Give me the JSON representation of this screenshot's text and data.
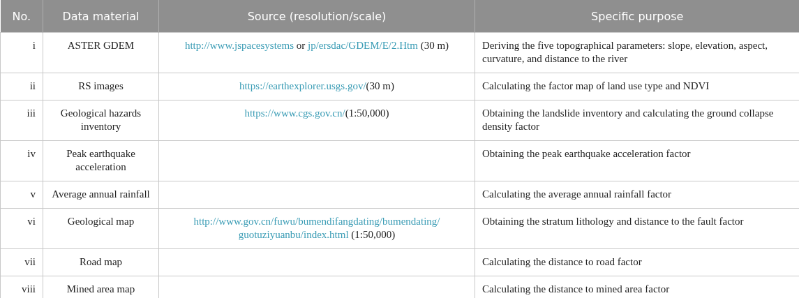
{
  "table": {
    "columns": [
      "No.",
      "Data material",
      "Source (resolution/scale)",
      "Specific purpose"
    ],
    "rows": [
      {
        "no": "i",
        "material": "ASTER GDEM",
        "source": [
          [
            {
              "kind": "link",
              "text": "http://www.jspacesystems"
            },
            {
              "kind": "plain",
              "text": "or"
            },
            {
              "kind": "link",
              "text": "jp/ersdac/GDEM/E/2.Htm"
            },
            {
              "kind": "plain",
              "text": "(30 m)"
            }
          ]
        ],
        "purpose": "Deriving the five topographical parameters: slope, elevation, aspect, curvature, and distance to the river"
      },
      {
        "no": "ii",
        "material": "RS images",
        "source": [
          [
            {
              "kind": "link",
              "text": "https://earthexplorer.usgs.gov/"
            },
            {
              "kind": "plain",
              "text": "(30 m)",
              "tight": true
            }
          ]
        ],
        "purpose": "Calculating the factor map of land use type and NDVI"
      },
      {
        "no": "iii",
        "material": "Geological hazards inventory",
        "source": [
          [
            {
              "kind": "link",
              "text": "https://www.cgs.gov.cn/"
            },
            {
              "kind": "plain",
              "text": "(1:50,000)",
              "tight": true
            }
          ]
        ],
        "purpose": "Obtaining the landslide inventory and calculating the ground collapse density factor"
      },
      {
        "no": "iv",
        "material": "Peak earthquake acceleration",
        "source": [],
        "purpose": "Obtaining the peak earthquake acceleration factor"
      },
      {
        "no": "v",
        "material": "Average annual rainfall",
        "source": [],
        "purpose": "Calculating the average annual rainfall factor"
      },
      {
        "no": "vi",
        "material": "Geological map",
        "source": [
          [
            {
              "kind": "link",
              "text": "http://www.gov.cn/fuwu/bumendifangdating/bumendating/"
            }
          ],
          [
            {
              "kind": "link",
              "text": "guotuziyuanbu/index.html"
            },
            {
              "kind": "plain",
              "text": "(1:50,000)"
            }
          ]
        ],
        "purpose": "Obtaining the stratum lithology and distance to the fault factor"
      },
      {
        "no": "vii",
        "material": "Road map",
        "source": [],
        "purpose": "Calculating the distance to road factor"
      },
      {
        "no": "viii",
        "material": "Mined area map",
        "source": [],
        "purpose": "Calculating the distance to mined area factor"
      }
    ]
  }
}
